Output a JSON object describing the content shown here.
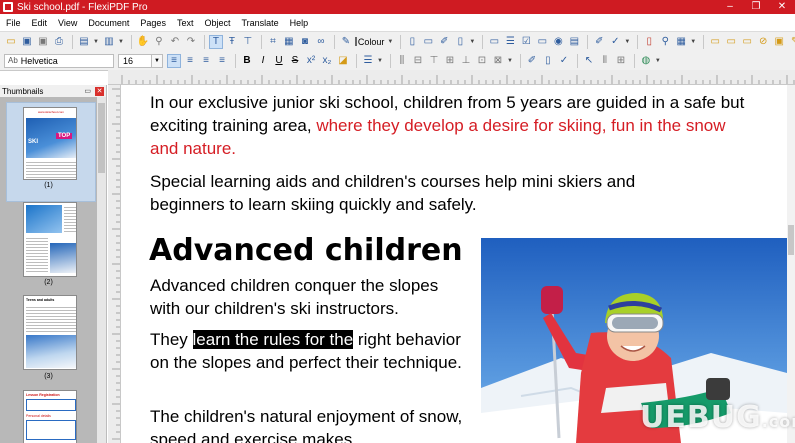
{
  "window": {
    "title": "Ski school.pdf - FlexiPDF Pro",
    "controls": [
      "–",
      "❐",
      "✕"
    ]
  },
  "menu": [
    "File",
    "Edit",
    "View",
    "Document",
    "Pages",
    "Text",
    "Object",
    "Translate",
    "Help"
  ],
  "toolbar": {
    "colour_label": "Colour",
    "text_color": "#000000"
  },
  "format_bar": {
    "font_name": "Helvetica",
    "font_prefix": "Ab",
    "font_size": "16"
  },
  "thumbnails": {
    "label": "Thumbnails",
    "pages": [
      "(1)",
      "(2)",
      "(3)"
    ],
    "page1_url": "www.skischool.com",
    "page1_badge": "TOP",
    "page1_ski": "SKI",
    "page3_heading": "Teens and adults",
    "page4_heading": "Lesson Registration",
    "page4_sub": "Personal details"
  },
  "document": {
    "p1": "In our exclusive junior ski school, children from 5 years are guided in a safe but exciting training area,",
    "p1_red": "where they develop a desire for skiing, fun in the snow and nature.",
    "p2": "Special learning aids and children's courses help mini skiers and beginners to learn skiing quickly and safely.",
    "heading": "Advanced children",
    "p3": "Advanced children conquer the slopes with our children's ski instructors.",
    "p4_before": "They",
    "p4_selected": "learn the rules for the",
    "p4_after": "right behavior on the slopes and perfect their technique.",
    "p5": "The children's natural enjoyment of snow, speed and exercise makes"
  },
  "colors": {
    "brand_red": "#cf1b22",
    "doc_red": "#d51d24",
    "selection": "#000000"
  },
  "watermark": {
    "text": "UEBUG",
    "suffix": ".com"
  }
}
